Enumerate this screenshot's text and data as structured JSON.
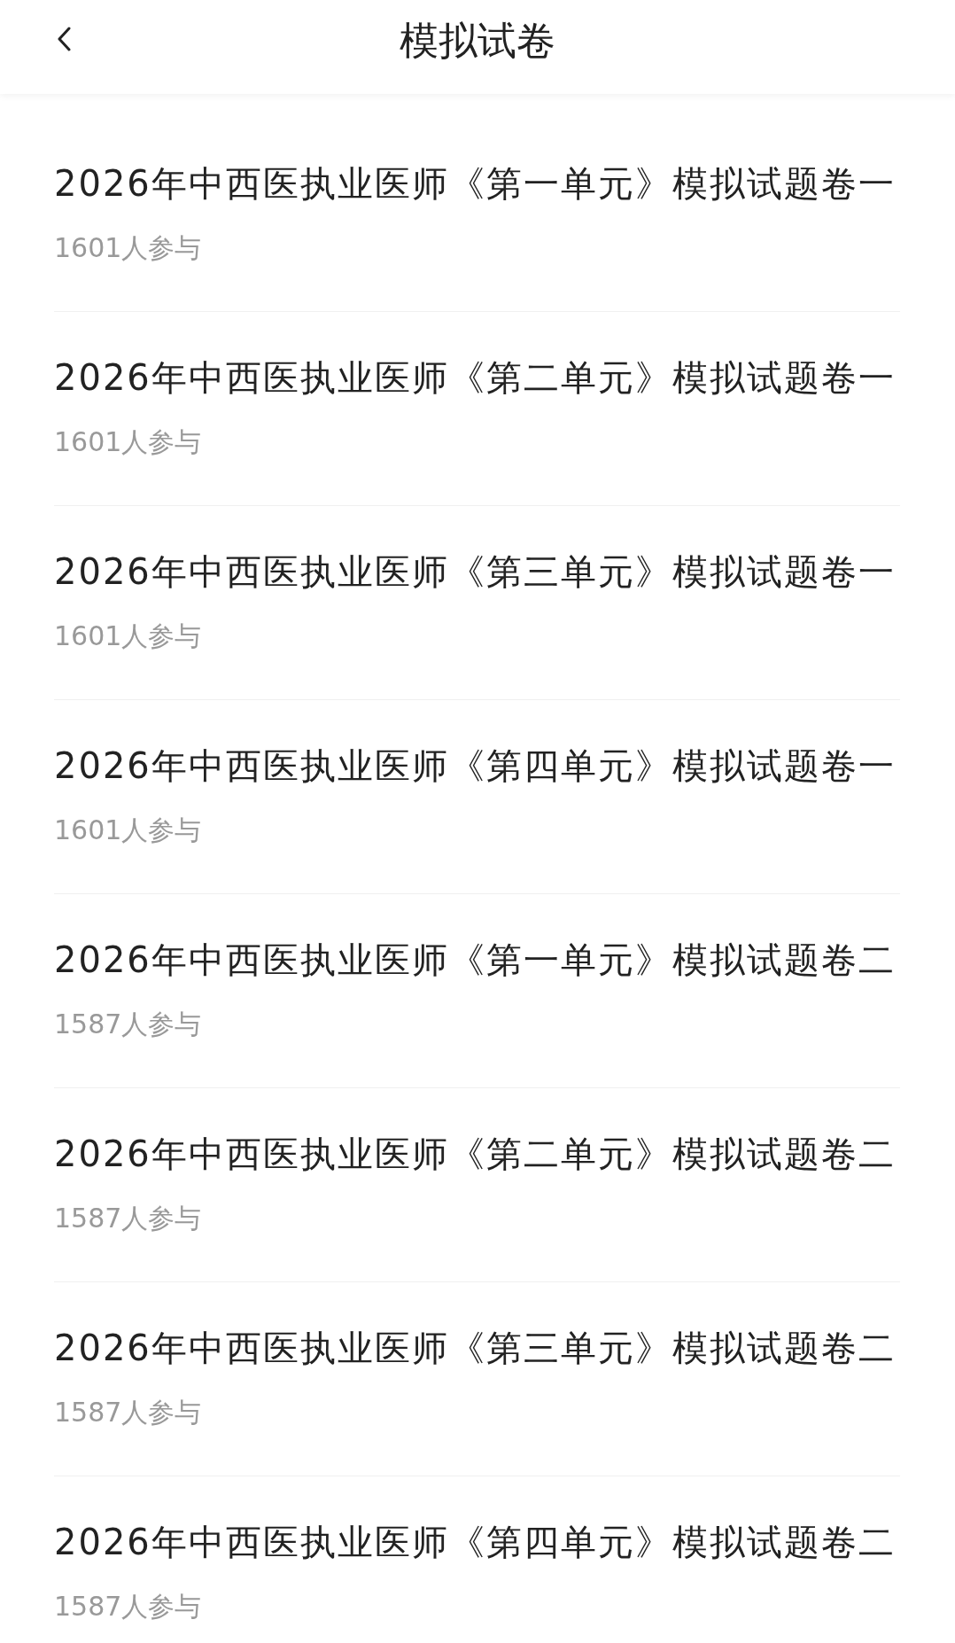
{
  "header": {
    "title": "模拟试卷"
  },
  "papers": [
    {
      "title": "2026年中西医执业医师《第一单元》模拟试题卷一",
      "participants": "1601人参与"
    },
    {
      "title": "2026年中西医执业医师《第二单元》模拟试题卷一",
      "participants": "1601人参与"
    },
    {
      "title": "2026年中西医执业医师《第三单元》模拟试题卷一",
      "participants": "1601人参与"
    },
    {
      "title": "2026年中西医执业医师《第四单元》模拟试题卷一",
      "participants": "1601人参与"
    },
    {
      "title": "2026年中西医执业医师《第一单元》模拟试题卷二",
      "participants": "1587人参与"
    },
    {
      "title": "2026年中西医执业医师《第二单元》模拟试题卷二",
      "participants": "1587人参与"
    },
    {
      "title": "2026年中西医执业医师《第三单元》模拟试题卷二",
      "participants": "1587人参与"
    },
    {
      "title": "2026年中西医执业医师《第四单元》模拟试题卷二",
      "participants": "1587人参与"
    }
  ]
}
